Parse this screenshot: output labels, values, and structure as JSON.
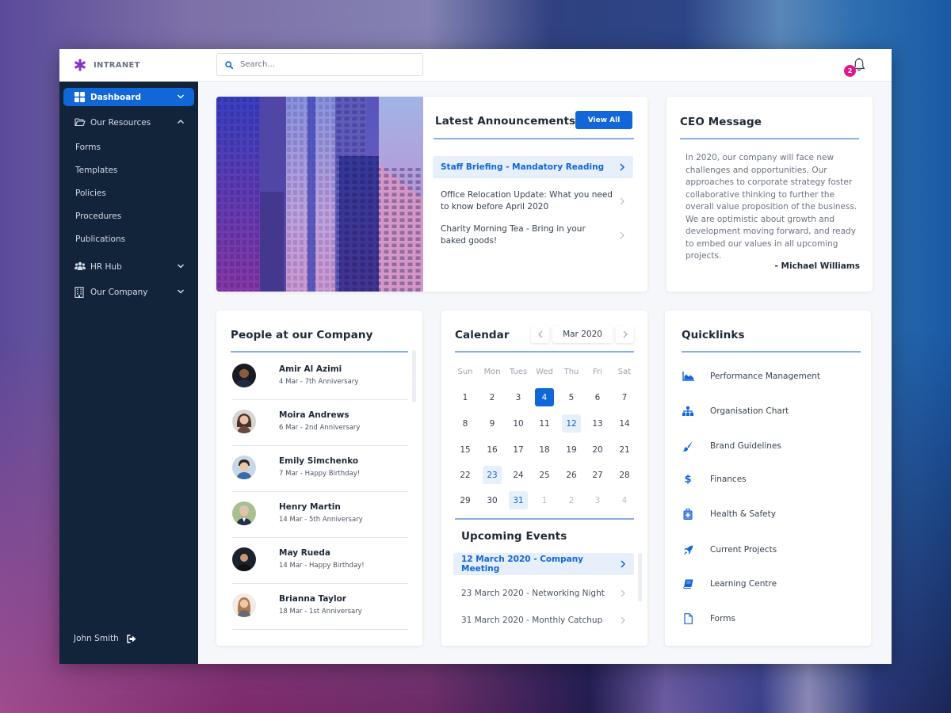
{
  "app": {
    "brand": "INTRANET"
  },
  "topbar": {
    "search_placeholder": "Search...",
    "notification_count": "2"
  },
  "sidebar": {
    "items": [
      {
        "label": "Dashboard",
        "icon": "grid-icon",
        "state": "active",
        "chevron": "down"
      },
      {
        "label": "Our Resources",
        "icon": "folder-open-icon",
        "state": "expanded",
        "chevron": "up"
      },
      {
        "label": "HR Hub",
        "icon": "users-icon",
        "chevron": "down"
      },
      {
        "label": "Our Company",
        "icon": "building-icon",
        "chevron": "down"
      }
    ],
    "resources_children": [
      "Forms",
      "Templates",
      "Policies",
      "Procedures",
      "Publications"
    ],
    "user_name": "John Smith",
    "logout_icon": "sign-out-icon"
  },
  "announcements": {
    "title": "Latest Announcements",
    "view_all_label": "View All",
    "items": [
      {
        "text": "Staff Briefing - Mandatory Reading",
        "active": true
      },
      {
        "text": "Office Relocation Update: What you need to know before April 2020",
        "active": false
      },
      {
        "text": "Charity Morning Tea - Bring in your baked goods!",
        "active": false
      }
    ]
  },
  "ceo": {
    "title": "CEO Message",
    "message": "In 2020, our company will face new challenges and opportunities. Our approaches to corporate strategy foster collaborative thinking to further the overall value proposition of the business. We are optimistic about growth and development moving forward, and ready to embed our values in all upcoming projects.",
    "signature": "- Michael Williams"
  },
  "people": {
    "title": "People at our Company",
    "items": [
      {
        "name": "Amir Al Azimi",
        "detail": "4 Mar - 7th Anniversary"
      },
      {
        "name": "Moira Andrews",
        "detail": "6 Mar - 2nd Anniversary"
      },
      {
        "name": "Emily Simchenko",
        "detail": "7 Mar - Happy Birthday!"
      },
      {
        "name": "Henry Martin",
        "detail": "14 Mar - 5th Anniversary"
      },
      {
        "name": "May Rueda",
        "detail": "14 Mar - Happy Birthday!"
      },
      {
        "name": "Brianna Taylor",
        "detail": "18 Mar - 1st Anniversary"
      }
    ]
  },
  "calendar": {
    "title": "Calendar",
    "month_label": "Mar 2020",
    "prev_label": "<",
    "next_label": ">",
    "weekdays": [
      "Sun",
      "Mon",
      "Tues",
      "Wed",
      "Thu",
      "Fri",
      "Sat"
    ],
    "weeks": [
      [
        "1",
        "2",
        "3",
        "4",
        "5",
        "6",
        "7"
      ],
      [
        "8",
        "9",
        "10",
        "11",
        "12",
        "13",
        "14"
      ],
      [
        "15",
        "16",
        "17",
        "18",
        "19",
        "20",
        "21"
      ],
      [
        "22",
        "23",
        "24",
        "25",
        "26",
        "27",
        "28"
      ],
      [
        "29",
        "30",
        "31",
        "1",
        "2",
        "3",
        "4"
      ]
    ],
    "today": "4",
    "event_days": [
      "12",
      "23",
      "31"
    ],
    "trailing_next_month_days": 4
  },
  "events": {
    "title": "Upcoming Events",
    "items": [
      {
        "text": "12 March 2020 - Company Meeting",
        "active": true
      },
      {
        "text": "23 March 2020 - Networking Night",
        "active": false
      },
      {
        "text": "31 March 2020 - Monthly Catchup",
        "active": false
      }
    ]
  },
  "quicklinks": {
    "title": "Quicklinks",
    "items": [
      {
        "label": "Performance Management",
        "icon": "area-chart-icon"
      },
      {
        "label": "Organisation Chart",
        "icon": "sitemap-icon"
      },
      {
        "label": "Brand Guidelines",
        "icon": "paint-brush-icon"
      },
      {
        "label": "Finances",
        "icon": "dollar-icon"
      },
      {
        "label": "Health & Safety",
        "icon": "first-aid-kit-icon"
      },
      {
        "label": "Current Projects",
        "icon": "rocket-icon"
      },
      {
        "label": "Learning Centre",
        "icon": "book-icon"
      },
      {
        "label": "Forms",
        "icon": "file-icon"
      }
    ]
  },
  "colors": {
    "accent": "#1166d8",
    "sidebar_bg": "#12243a",
    "badge": "#e0198a",
    "highlight_bg": "#e6effa",
    "rule": "#87aee8"
  }
}
